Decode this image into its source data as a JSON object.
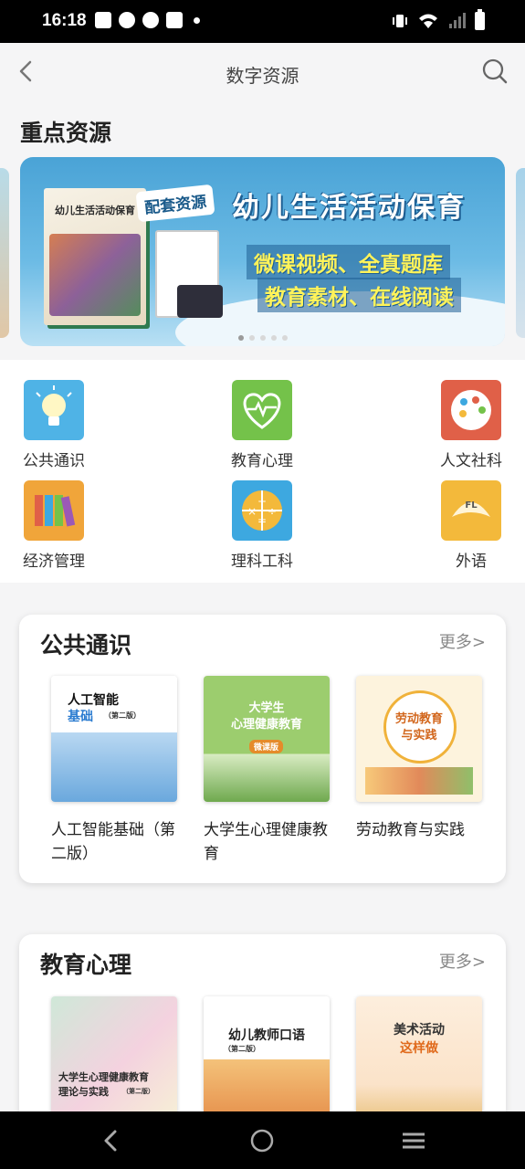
{
  "status": {
    "time": "16:18"
  },
  "appbar": {
    "title": "数字资源"
  },
  "featured": {
    "heading": "重点资源",
    "banner": {
      "book_title": "幼儿生活活动保育",
      "tag": "配套资源",
      "headline": "幼儿生活活动保育",
      "line1": "微课视频、全真题库",
      "line2": "教育素材、在线阅读",
      "page_count": 5,
      "active_page": 1
    }
  },
  "categories": [
    {
      "label": "公共通识",
      "icon": "lightbulb-icon"
    },
    {
      "label": "教育心理",
      "icon": "heart-pulse-icon"
    },
    {
      "label": "人文社科",
      "icon": "palette-icon"
    },
    {
      "label": "经济管理",
      "icon": "books-icon"
    },
    {
      "label": "理科工科",
      "icon": "math-operators-icon"
    },
    {
      "label": "外语",
      "icon": "foreign-language-icon"
    }
  ],
  "sections": [
    {
      "title": "公共通识",
      "more": "更多>",
      "books": [
        {
          "name": "人工智能基础（第二版）",
          "cover_title": "人工智能",
          "cover_sub": "基础",
          "cover_edition": "（第二版）"
        },
        {
          "name": "大学生心理健康教育",
          "cover_title": "大学生",
          "cover_sub": "心理健康教育",
          "cover_badge": "微课版"
        },
        {
          "name": "劳动教育与实践",
          "cover_title": "劳动教育",
          "cover_sub": "与实践"
        }
      ]
    },
    {
      "title": "教育心理",
      "more": "更多>",
      "books": [
        {
          "cover_title": "大学生心理健康教育",
          "cover_sub": "理论与实践",
          "cover_edition": "（第二版）"
        },
        {
          "cover_title": "幼儿教师口语",
          "cover_edition": "（第二版）"
        },
        {
          "cover_title": "美术活动",
          "cover_sub": "这样做"
        }
      ]
    }
  ],
  "colors": {
    "accent_blue": "#4aa3d6",
    "page_bg": "#f5f5f6",
    "muted_text": "#888888"
  }
}
